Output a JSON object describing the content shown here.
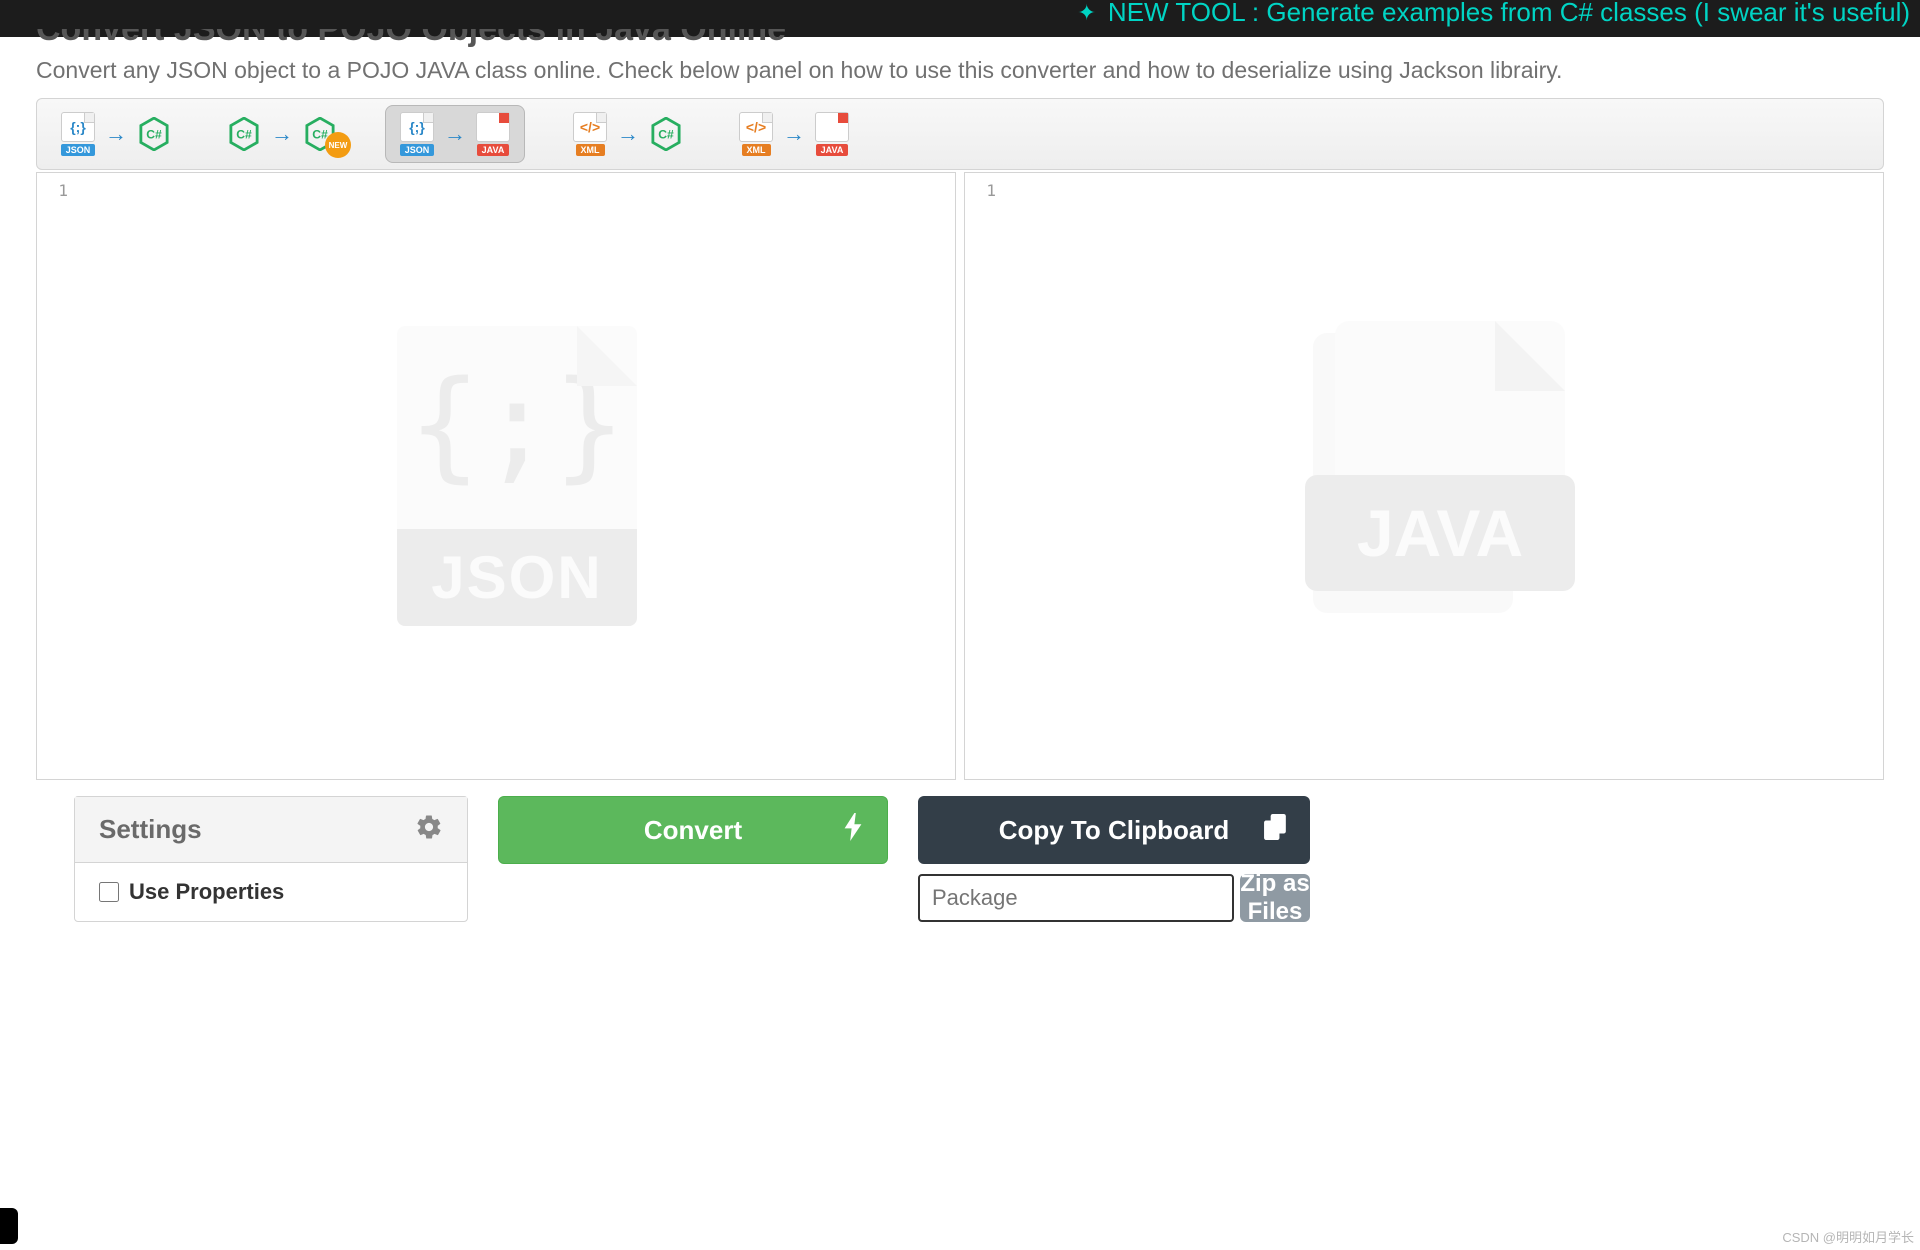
{
  "banner": {
    "text": "NEW TOOL : Generate examples from C# classes (I swear it's useful)"
  },
  "page": {
    "title": "Convert JSON to POJO Objects in Java Online",
    "subtitle": "Convert any JSON object to a POJO JAVA class online. Check below panel on how to use this converter and how to deserialize using Jackson librairy."
  },
  "tabs": {
    "json_label": "JSON",
    "xml_label": "XML",
    "java_label": "JAVA",
    "new_badge": "NEW"
  },
  "editors": {
    "left_line": "1",
    "right_line": "1",
    "left_watermark": "JSON",
    "right_watermark": "JAVA"
  },
  "settings": {
    "title": "Settings",
    "use_properties": "Use Properties"
  },
  "buttons": {
    "convert": "Convert",
    "copy": "Copy To Clipboard",
    "zip": "Zip as Files"
  },
  "inputs": {
    "package_placeholder": "Package"
  },
  "credit": "CSDN @明明如月学长"
}
